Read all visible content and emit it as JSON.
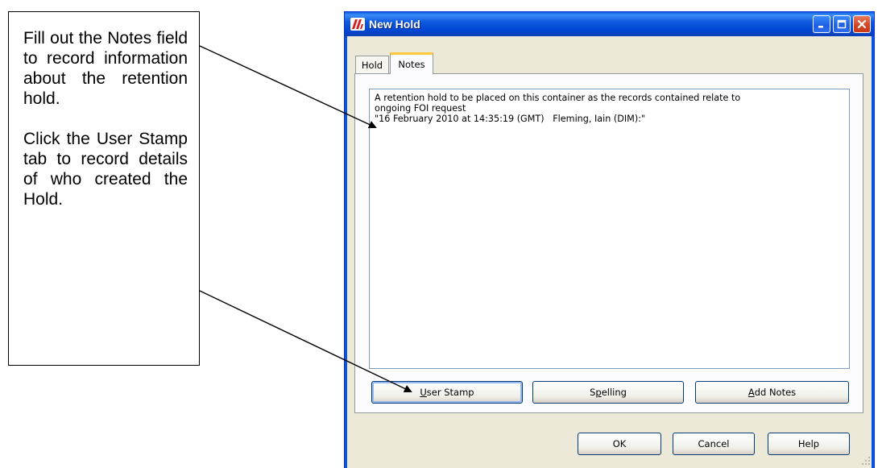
{
  "callout": {
    "paragraph1": "Fill out the Notes field to record information about the retention hold.",
    "paragraph2": "Click the User Stamp tab to record details of who created the Hold."
  },
  "window": {
    "title": "New Hold",
    "icon": "app-logo-icon",
    "controls": [
      "minimize-icon",
      "maximize-icon",
      "close-icon"
    ]
  },
  "tabs": [
    {
      "label": "Hold",
      "selected": false
    },
    {
      "label": "Notes",
      "selected": true
    }
  ],
  "notes": {
    "text": "A retention hold to be placed on this container as the records contained relate to\nongoing FOI request\n\"16 February 2010 at 14:35:19 (GMT)   Fleming, Iain (DIM):\""
  },
  "note_buttons": {
    "user_stamp": {
      "mnemonic": "U",
      "rest": "ser Stamp"
    },
    "spelling": {
      "lead": "S",
      "mnemonic": "p",
      "rest": "elling"
    },
    "add_notes": {
      "mnemonic": "A",
      "rest": "dd Notes"
    }
  },
  "dialog_buttons": {
    "ok": "OK",
    "cancel": "Cancel",
    "help": "Help"
  },
  "colors": {
    "titlebar": "#0046d5",
    "close_button": "#d2441f",
    "tab_highlight": "#ffc83c",
    "window_face": "#ece9d8"
  }
}
